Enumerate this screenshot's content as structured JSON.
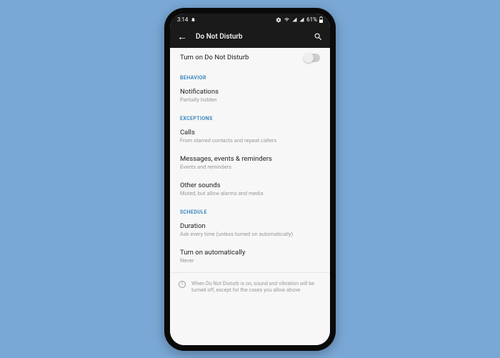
{
  "status": {
    "time": "3:14",
    "battery_pct": "61%"
  },
  "appbar": {
    "title": "Do Not Disturb"
  },
  "toggle_row": {
    "label": "Turn on Do Not Disturb"
  },
  "sections": {
    "behavior": {
      "header": "BEHAVIOR",
      "notifications": {
        "title": "Notifications",
        "sub": "Partially hidden"
      }
    },
    "exceptions": {
      "header": "EXCEPTIONS",
      "calls": {
        "title": "Calls",
        "sub": "From starred contacts and repeat callers"
      },
      "messages": {
        "title": "Messages, events & reminders",
        "sub": "Events and reminders"
      },
      "other": {
        "title": "Other sounds",
        "sub": "Muted, but allow alarms and media"
      }
    },
    "schedule": {
      "header": "SCHEDULE",
      "duration": {
        "title": "Duration",
        "sub": "Ask every time (unless turned on automatically)"
      },
      "auto": {
        "title": "Turn on automatically",
        "sub": "Never"
      }
    }
  },
  "footer": {
    "text": "When Do Not Disturb is on, sound and vibration will be turned off, except for the cases you allow above"
  }
}
